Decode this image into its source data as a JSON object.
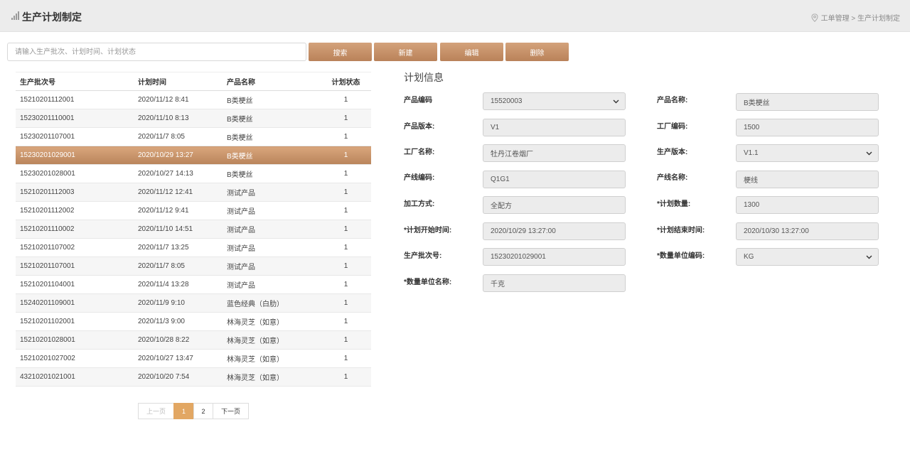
{
  "header": {
    "title": "生产计划制定",
    "breadcrumb": "工单管理 > 生产计划制定"
  },
  "search": {
    "placeholder": "请输入生产批次、计划时间、计划状态",
    "value": ""
  },
  "toolbar": {
    "search_label": "搜索",
    "new_label": "新建",
    "edit_label": "编辑",
    "delete_label": "删除"
  },
  "table": {
    "columns": [
      "生产批次号",
      "计划时间",
      "产品名称",
      "计划状态"
    ],
    "rows": [
      {
        "batch": "15210201112001",
        "time": "2020/11/12 8:41",
        "product": "B类梗丝",
        "status": "1"
      },
      {
        "batch": "15230201110001",
        "time": "2020/11/10 8:13",
        "product": "B类梗丝",
        "status": "1"
      },
      {
        "batch": "15230201107001",
        "time": "2020/11/7 8:05",
        "product": "B类梗丝",
        "status": "1"
      },
      {
        "batch": "15230201029001",
        "time": "2020/10/29 13:27",
        "product": "B类梗丝",
        "status": "1"
      },
      {
        "batch": "15230201028001",
        "time": "2020/10/27 14:13",
        "product": "B类梗丝",
        "status": "1"
      },
      {
        "batch": "15210201112003",
        "time": "2020/11/12 12:41",
        "product": "测试产品",
        "status": "1"
      },
      {
        "batch": "15210201112002",
        "time": "2020/11/12 9:41",
        "product": "测试产品",
        "status": "1"
      },
      {
        "batch": "15210201110002",
        "time": "2020/11/10 14:51",
        "product": "测试产品",
        "status": "1"
      },
      {
        "batch": "15210201107002",
        "time": "2020/11/7 13:25",
        "product": "测试产品",
        "status": "1"
      },
      {
        "batch": "15210201107001",
        "time": "2020/11/7 8:05",
        "product": "测试产品",
        "status": "1"
      },
      {
        "batch": "15210201104001",
        "time": "2020/11/4 13:28",
        "product": "测试产品",
        "status": "1"
      },
      {
        "batch": "15240201109001",
        "time": "2020/11/9 9:10",
        "product": "蓝色经典（白肋）",
        "status": "1"
      },
      {
        "batch": "15210201102001",
        "time": "2020/11/3 9:00",
        "product": "林海灵芝（如意）",
        "status": "1"
      },
      {
        "batch": "15210201028001",
        "time": "2020/10/28 8:22",
        "product": "林海灵芝（如意）",
        "status": "1"
      },
      {
        "batch": "15210201027002",
        "time": "2020/10/27 13:47",
        "product": "林海灵芝（如意）",
        "status": "1"
      },
      {
        "batch": "43210201021001",
        "time": "2020/10/20 7:54",
        "product": "林海灵芝（如意）",
        "status": "1"
      }
    ],
    "selected_index": 3
  },
  "pagination": {
    "prev": "上一页",
    "pages": [
      "1",
      "2"
    ],
    "current": "1",
    "next": "下一页"
  },
  "form": {
    "title": "计划信息",
    "product_code_label": "产品编码",
    "product_code": "15520003",
    "product_name_label": "产品名称:",
    "product_name": "B类梗丝",
    "product_version_label": "产品版本:",
    "product_version": "V1",
    "factory_code_label": "工厂编码:",
    "factory_code": "1500",
    "factory_name_label": "工厂名称:",
    "factory_name": "牡丹江卷烟厂",
    "prod_version_label": "生产版本:",
    "prod_version": "V1.1",
    "line_code_label": "产线编码:",
    "line_code": "Q1G1",
    "line_name_label": "产线名称:",
    "line_name": "梗线",
    "process_label": "加工方式:",
    "process": "全配方",
    "plan_qty_label": "*计划数量:",
    "plan_qty": "1300",
    "start_label": "*计划开始时间:",
    "start": "2020/10/29 13:27:00",
    "end_label": "*计划结束时间:",
    "end": "2020/10/30 13:27:00",
    "batch_label": "生产批次号:",
    "batch": "15230201029001",
    "unit_code_label": "*数量单位编码:",
    "unit_code": "KG",
    "unit_name_label": "*数量单位名称:",
    "unit_name": "千克"
  },
  "colors": {
    "accent": "#c58f65",
    "page_active": "#e2a763",
    "header_bg": "#ececec"
  },
  "icons": {
    "logo": "bar-chart-icon",
    "breadcrumb": "location-pin-icon",
    "select": "chevron-down-icon"
  }
}
